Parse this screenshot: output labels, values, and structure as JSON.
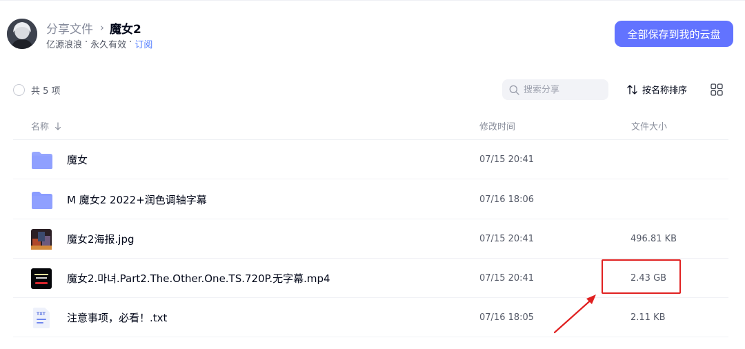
{
  "header": {
    "breadcrumb_root": "分享文件",
    "breadcrumb_sep": "›",
    "breadcrumb_current": "魔女2",
    "owner": "亿源浪浪",
    "meta_dot": "·",
    "validity": "永久有效",
    "subscribe_label": "订阅",
    "save_all_label": "全部保存到我的云盘"
  },
  "toolbar": {
    "count_label": "共 5 项",
    "search_placeholder": "搜索分享",
    "search_value": "",
    "sort_label": "按名称排序"
  },
  "table": {
    "columns": {
      "name": "名称",
      "time": "修改时间",
      "size": "文件大小"
    },
    "rows": [
      {
        "icon": "folder-icon",
        "name": "魔女",
        "time": "07/15 20:41",
        "size": ""
      },
      {
        "icon": "folder-icon",
        "name": "M 魔女2 2022+润色调轴字幕",
        "time": "07/16 18:06",
        "size": ""
      },
      {
        "icon": "image-thumbnail-icon",
        "name": "魔女2海报.jpg",
        "time": "07/15 20:41",
        "size": "496.81 KB"
      },
      {
        "icon": "video-thumbnail-icon",
        "name": "魔女2.마녀.Part2.The.Other.One.TS.720P.无字幕.mp4",
        "time": "07/15 20:41",
        "size": "2.43 GB"
      },
      {
        "icon": "txt-file-icon",
        "name": "注意事项，必看！.txt",
        "time": "07/16 18:05",
        "size": "2.11 KB"
      }
    ]
  },
  "colors": {
    "accent": "#6273ff",
    "link": "#4e7aff",
    "annotation": "#e02020",
    "folder": "#8a9cff"
  }
}
